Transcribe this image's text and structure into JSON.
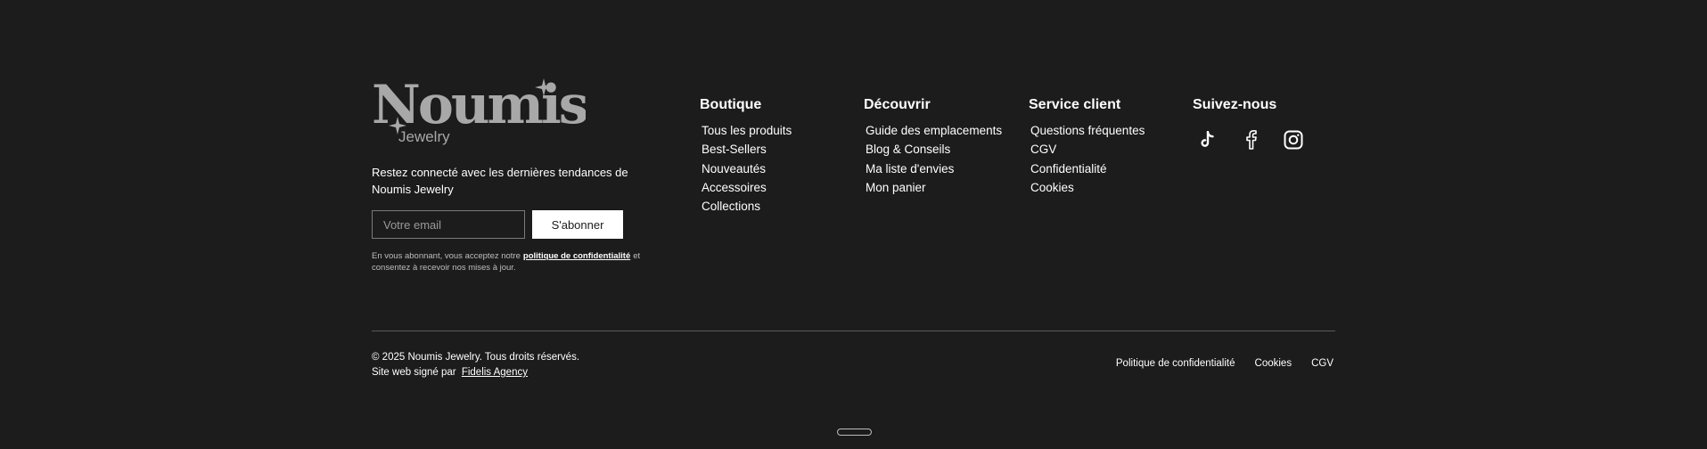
{
  "brand": {
    "logo_wordmark": "Noumis",
    "logo_sub": "Jewelry",
    "logo_color": "#a8a8a8"
  },
  "newsletter": {
    "tagline": "Restez connecté avec les dernières tendances de Noumis Jewelry",
    "email_placeholder": "Votre email",
    "subscribe_label": "S'abonner",
    "legal_before": "En vous abonnant, vous acceptez notre",
    "legal_link": "politique de confidentialité",
    "legal_after": "et consentez à recevoir nos mises à jour."
  },
  "columns": {
    "boutique": {
      "title": "Boutique",
      "items": [
        "Tous les produits",
        "Best-Sellers",
        "Nouveautés",
        "Accessoires",
        "Collections"
      ]
    },
    "decouvrir": {
      "title": "Découvrir",
      "items": [
        "Guide des emplacements",
        "Blog & Conseils",
        "Ma liste d'envies",
        "Mon panier"
      ]
    },
    "service": {
      "title": "Service client",
      "items": [
        "Questions fréquentes",
        "CGV",
        "Confidentialité",
        "Cookies"
      ]
    },
    "social": {
      "title": "Suivez-nous",
      "icons": [
        "tiktok-icon",
        "facebook-icon",
        "instagram-icon"
      ]
    }
  },
  "bottom": {
    "copyright": "© 2025 Noumis Jewelry. Tous droits réservés.",
    "credit_prefix": "Site web signé par",
    "credit_link": "Fidelis Agency",
    "links": [
      "Politique de confidentialité",
      "Cookies",
      "CGV"
    ]
  },
  "colors": {
    "background": "#1c1c1c",
    "text": "#ffffff",
    "muted": "#bdbdbd",
    "divider": "#5a5a5a"
  }
}
